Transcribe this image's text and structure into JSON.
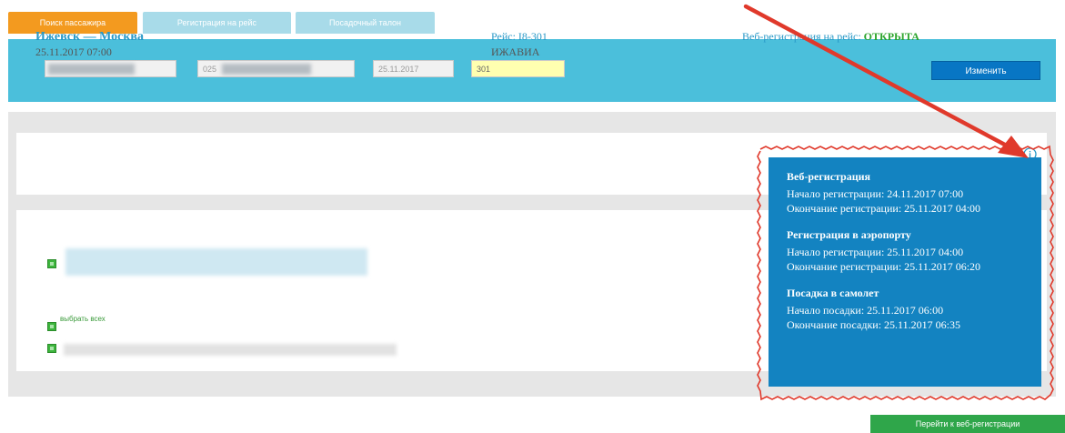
{
  "tabs": [
    {
      "label": "Поиск пассажира",
      "active": true
    },
    {
      "label": "Регистрация на рейс",
      "active": false
    },
    {
      "label": "Посадочный талон",
      "active": false
    }
  ],
  "search": {
    "surname_value": "",
    "ticket_value": "025",
    "date_value": "25.11.2017",
    "flight_value": "301",
    "change_label": "Изменить"
  },
  "flight": {
    "route": "Ижевск — Москва",
    "datetime": "25.11.2017 07:00",
    "flight_label": "Рейс: I8-301",
    "carrier": "ИЖАВИА",
    "webreg_label": "Веб-регистрация на рейс:",
    "webreg_status": "ОТКРЫТА"
  },
  "passengers": {
    "select_all_label": "выбрать всех"
  },
  "info_popup": {
    "sections": [
      {
        "title": "Веб-регистрация",
        "start": "Начало регистрации: 24.11.2017 07:00",
        "end": "Окончание регистрации: 25.11.2017 04:00"
      },
      {
        "title": "Регистрация в аэропорту",
        "start": "Начало регистрации: 25.11.2017 04:00",
        "end": "Окончание регистрации: 25.11.2017 06:20"
      },
      {
        "title": "Посадка в самолет",
        "start": "Начало посадки: 25.11.2017 06:00",
        "end": "Окончание посадки: 25.11.2017 06:35"
      }
    ]
  },
  "proceed_label": "Перейти к веб-регистрации",
  "colors": {
    "accent_orange": "#f39a1f",
    "panel_blue": "#4bbfdb",
    "popup_blue": "#1383c1",
    "annotation_red": "#e0392b",
    "status_green": "#2da52d"
  },
  "icons": {
    "info": "info-icon",
    "arrow": "annotation-arrow"
  }
}
